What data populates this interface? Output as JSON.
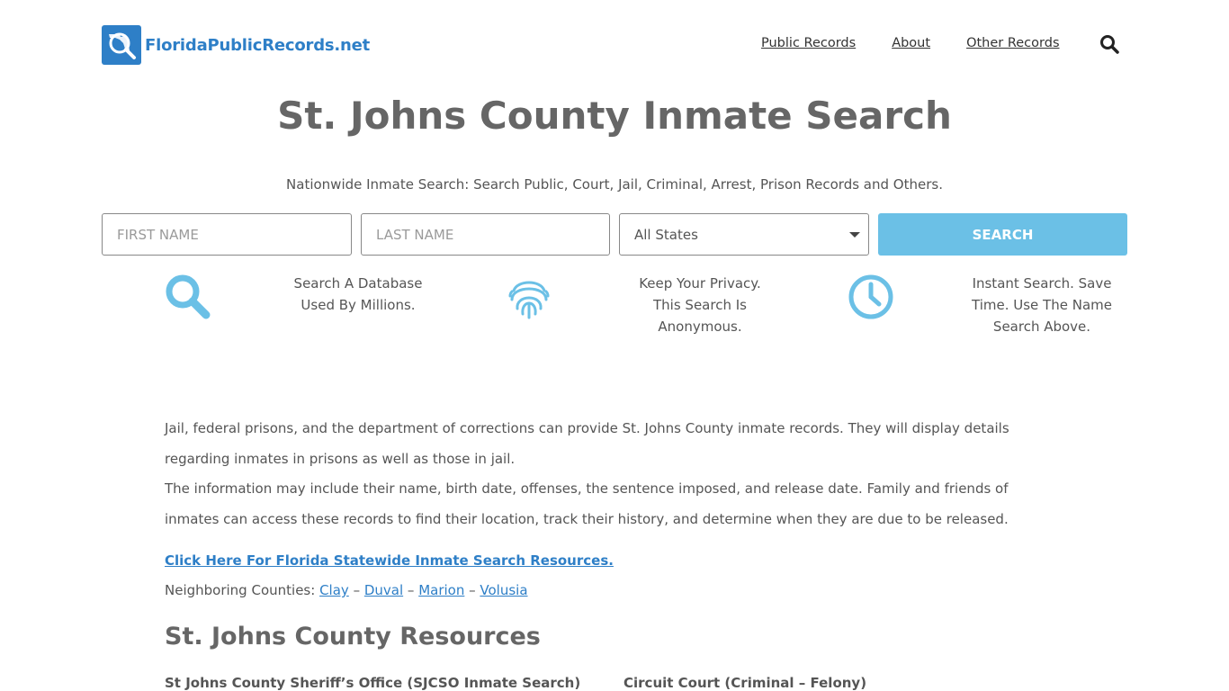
{
  "header": {
    "logo_text": "FloridaPublicRecords.net",
    "logo_icon": "florida-magnifier-icon",
    "nav": [
      {
        "label": "Public Records"
      },
      {
        "label": "About"
      },
      {
        "label": "Other Records"
      }
    ],
    "search_icon": "search-icon"
  },
  "title": "St. Johns County Inmate Search",
  "subtitle": "Nationwide Inmate Search: Search Public, Court, Jail, Criminal, Arrest, Prison Records and Others.",
  "form": {
    "first_name_placeholder": "FIRST NAME",
    "last_name_placeholder": "LAST NAME",
    "state_selected": "All States",
    "search_label": "SEARCH"
  },
  "features": [
    {
      "icon": "search-icon",
      "text": "Search A Database Used By Millions."
    },
    {
      "icon": "fingerprint-icon",
      "text": "Keep Your Privacy. This Search Is Anonymous."
    },
    {
      "icon": "clock-icon",
      "text": "Instant Search. Save Time. Use The Name Search Above."
    }
  ],
  "content": {
    "para1": "Jail, federal prisons, and the department of corrections can provide St. Johns County inmate records. They will display details regarding inmates in prisons as well as those in jail.",
    "para2": "The information may include their name, birth date, offenses, the sentence imposed, and release date. Family and friends of inmates can access these records to find their location, track their history, and determine when they are due to be released.",
    "statewide_link": "Click Here For Florida Statewide Inmate Search Resources.",
    "neighbors_label": "Neighboring Counties:",
    "neighbors": [
      "Clay",
      "Duval",
      "Marion",
      "Volusia"
    ],
    "separator": " – "
  },
  "resources": {
    "heading": "St. Johns County Resources",
    "items": [
      "St Johns County Sheriff’s Office (SJCSO Inmate Search)",
      "Circuit Court (Criminal – Felony)"
    ]
  },
  "colors": {
    "brand": "#2e7fc7",
    "button": "#6bc0e6",
    "icon": "#6bc0e6",
    "text": "#555555",
    "heading": "#666666"
  }
}
